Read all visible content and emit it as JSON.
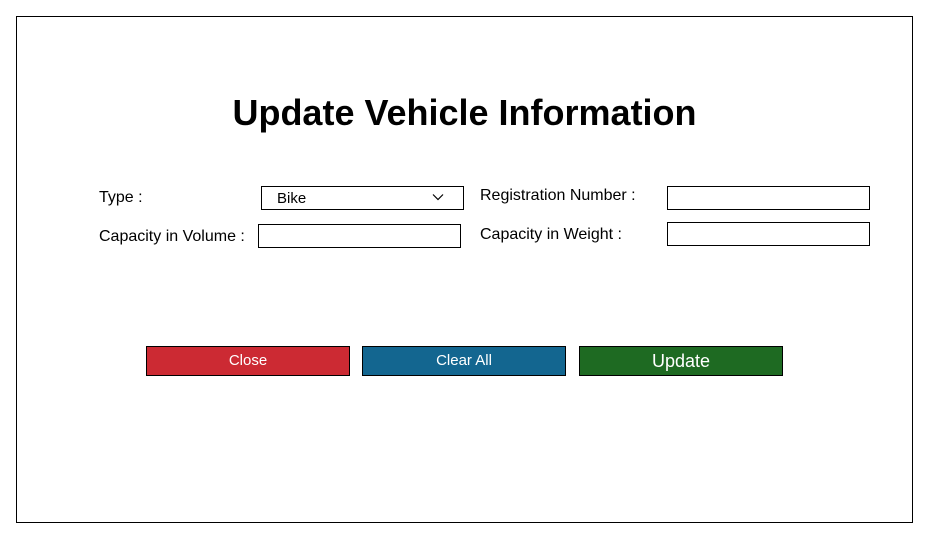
{
  "form": {
    "title": "Update Vehicle Information",
    "fields": {
      "type_label": "Type :",
      "type_value": "Bike",
      "registration_label": "Registration Number :",
      "registration_value": "",
      "volume_label": "Capacity in Volume :",
      "volume_value": "",
      "weight_label": "Capacity in Weight :",
      "weight_value": ""
    },
    "buttons": {
      "close": "Close",
      "clear_all": "Clear All",
      "update": "Update"
    }
  },
  "colors": {
    "close_button": "#cc2a33",
    "clear_button": "#136690",
    "update_button": "#1e6a22"
  },
  "icons": {
    "type_dropdown": "chevron-down-icon"
  }
}
